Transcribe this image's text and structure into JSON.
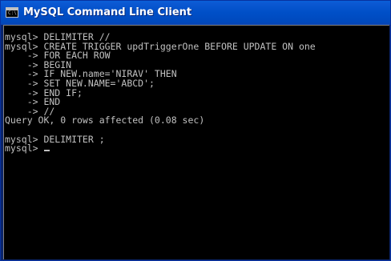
{
  "window": {
    "title": "MySQL Command Line Client",
    "icon": "console-app-icon",
    "icon_glyph": "C:\\"
  },
  "console": {
    "lines": [
      "mysql> DELIMITER //",
      "mysql> CREATE TRIGGER updTriggerOne BEFORE UPDATE ON one",
      "    -> FOR EACH ROW",
      "    -> BEGIN",
      "    -> IF NEW.name='NIRAV' THEN",
      "    -> SET NEW.NAME='ABCD';",
      "    -> END IF;",
      "    -> END",
      "    -> //",
      "Query OK, 0 rows affected (0.08 sec)",
      "",
      "mysql> DELIMITER ;",
      "mysql> "
    ]
  },
  "colors": {
    "titlebar": "#0054e3",
    "console_background": "#000000",
    "console_text": "#c0c0c0"
  }
}
